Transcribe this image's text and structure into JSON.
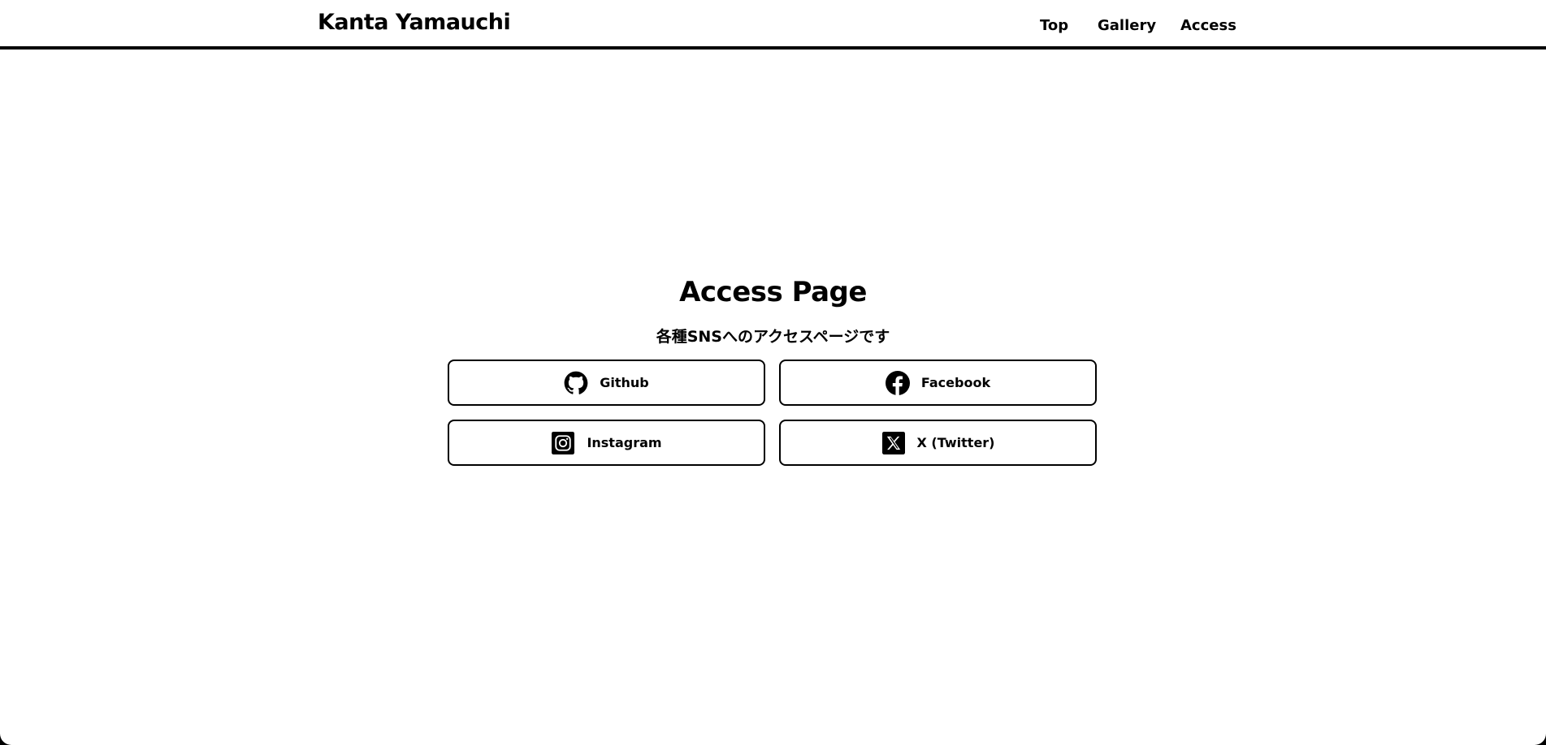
{
  "header": {
    "site_title": "Kanta Yamauchi",
    "nav": [
      {
        "label": "Top"
      },
      {
        "label": "Gallery"
      },
      {
        "label": "Access"
      }
    ]
  },
  "main": {
    "title": "Access Page",
    "subtitle": "各種SNSへのアクセスページです",
    "links": [
      {
        "label": "Github",
        "icon": "github-icon"
      },
      {
        "label": "Facebook",
        "icon": "facebook-icon"
      },
      {
        "label": "Instagram",
        "icon": "instagram-icon"
      },
      {
        "label": "X (Twitter)",
        "icon": "x-twitter-icon"
      }
    ]
  },
  "colors": {
    "background": "#ffffff",
    "text": "#000000",
    "border": "#000000"
  }
}
